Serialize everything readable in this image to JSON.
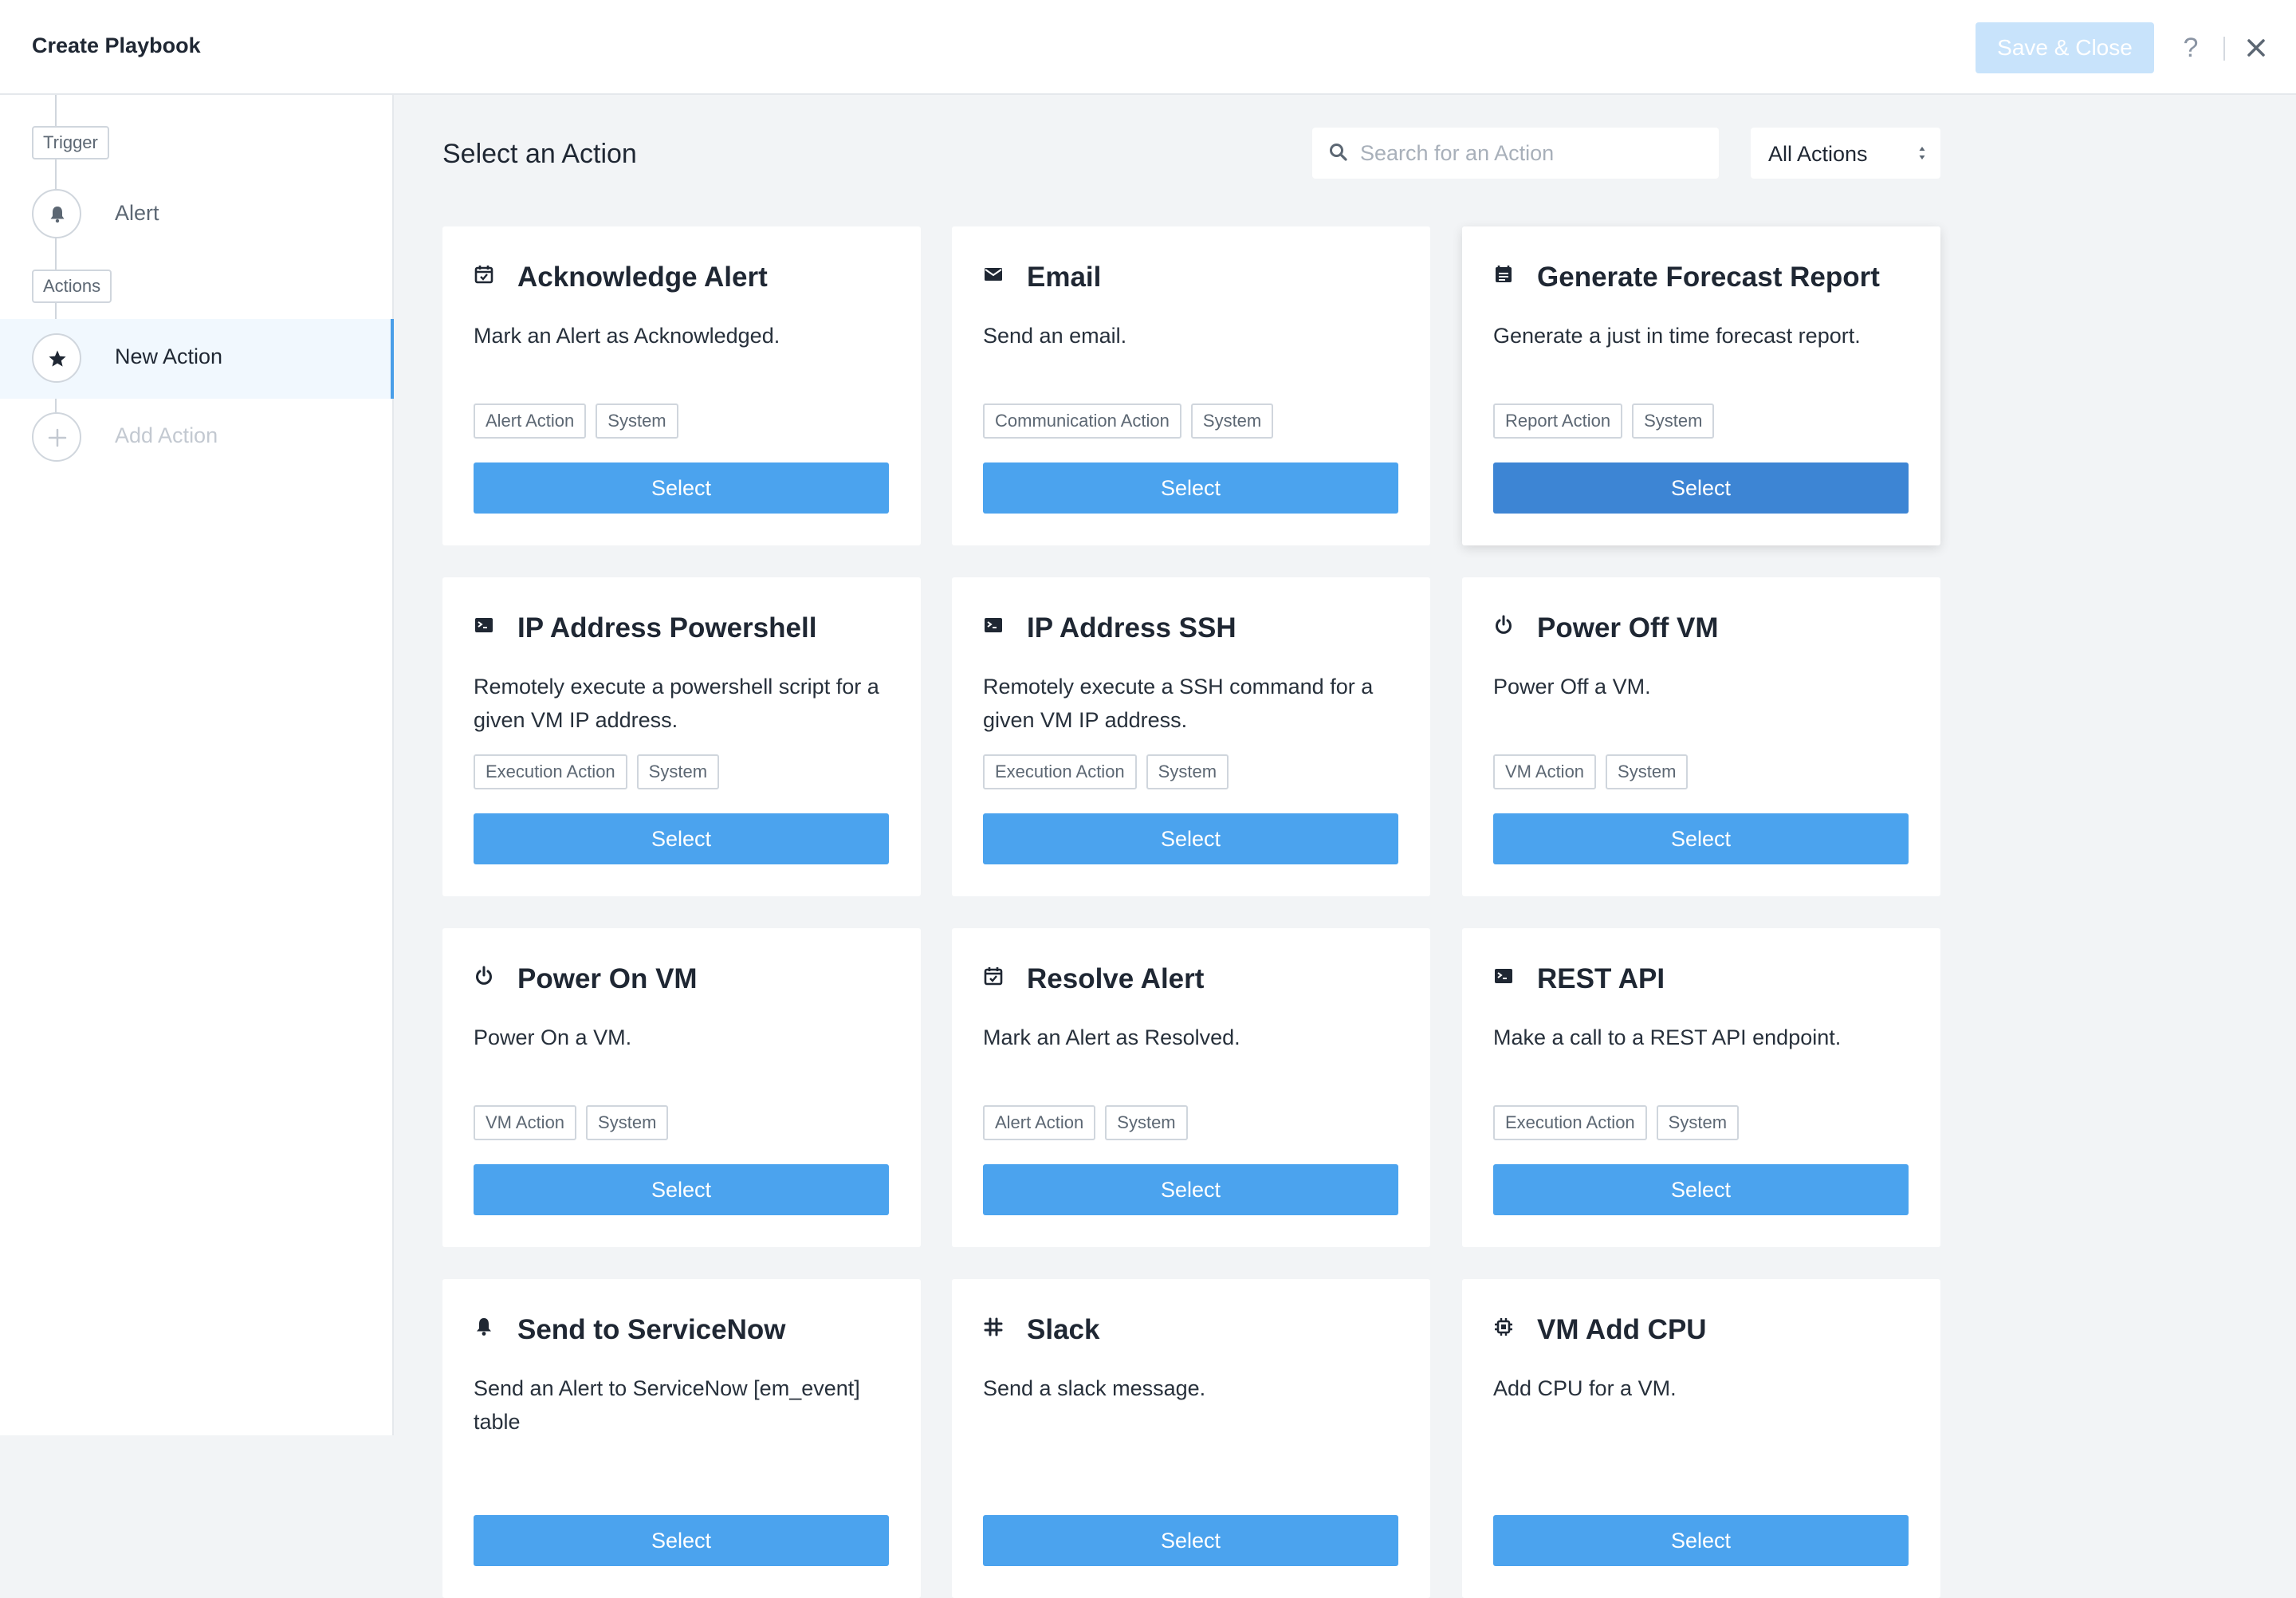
{
  "header": {
    "title": "Create Playbook",
    "save_label": "Save & Close",
    "help_label": "?"
  },
  "sidebar": {
    "trigger_label": "Trigger",
    "trigger_item": "Alert",
    "actions_label": "Actions",
    "new_action": "New Action",
    "add_action": "Add Action"
  },
  "main": {
    "title": "Select an Action",
    "search_placeholder": "Search for an Action",
    "filter_value": "All Actions"
  },
  "cards": [
    {
      "icon": "calendar-check-icon",
      "title": "Acknowledge Alert",
      "desc": "Mark an Alert as Acknowledged.",
      "tags": [
        "Alert Action",
        "System"
      ],
      "button": "Select"
    },
    {
      "icon": "envelope-icon",
      "title": "Email",
      "desc": "Send an email.",
      "tags": [
        "Communication Action",
        "System"
      ],
      "button": "Select"
    },
    {
      "icon": "report-icon",
      "title": "Generate Forecast Report",
      "desc": "Generate a just in time forecast report.",
      "tags": [
        "Report Action",
        "System"
      ],
      "button": "Select"
    },
    {
      "icon": "terminal-icon",
      "title": "IP Address Powershell",
      "desc": "Remotely execute a powershell script for a given VM IP address.",
      "tags": [
        "Execution Action",
        "System"
      ],
      "button": "Select"
    },
    {
      "icon": "terminal-icon",
      "title": "IP Address SSH",
      "desc": "Remotely execute a SSH command for a given VM IP address.",
      "tags": [
        "Execution Action",
        "System"
      ],
      "button": "Select"
    },
    {
      "icon": "power-icon",
      "title": "Power Off VM",
      "desc": "Power Off a VM.",
      "tags": [
        "VM Action",
        "System"
      ],
      "button": "Select"
    },
    {
      "icon": "power-icon",
      "title": "Power On VM",
      "desc": "Power On a VM.",
      "tags": [
        "VM Action",
        "System"
      ],
      "button": "Select"
    },
    {
      "icon": "calendar-check-icon",
      "title": "Resolve Alert",
      "desc": "Mark an Alert as Resolved.",
      "tags": [
        "Alert Action",
        "System"
      ],
      "button": "Select"
    },
    {
      "icon": "terminal-icon",
      "title": "REST API",
      "desc": "Make a call to a REST API endpoint.",
      "tags": [
        "Execution Action",
        "System"
      ],
      "button": "Select"
    },
    {
      "icon": "bell-icon",
      "title": "Send to ServiceNow",
      "desc": "Send an Alert to ServiceNow [em_event] table",
      "tags": [],
      "button": "Select"
    },
    {
      "icon": "slack-icon",
      "title": "Slack",
      "desc": "Send a slack message.",
      "tags": [],
      "button": "Select"
    },
    {
      "icon": "cpu-icon",
      "title": "VM Add CPU",
      "desc": "Add CPU for a VM.",
      "tags": [],
      "button": "Select"
    }
  ]
}
